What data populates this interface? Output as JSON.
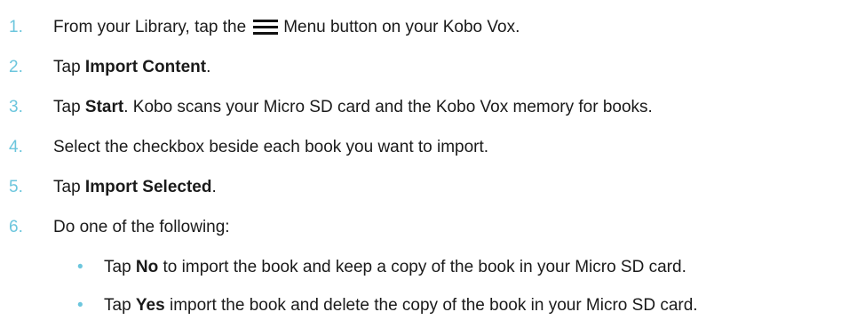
{
  "steps": [
    {
      "number": "1.",
      "before": "From your Library, tap the",
      "icon": "menu-icon",
      "after": "Menu button on your Kobo Vox."
    },
    {
      "number": "2.",
      "before": "Tap ",
      "bold": "Import Content",
      "after": "."
    },
    {
      "number": "3.",
      "before": "Tap ",
      "bold": "Start",
      "after": ". Kobo scans your Micro SD card and the Kobo Vox memory for books."
    },
    {
      "number": "4.",
      "text": "Select the checkbox beside each book you want to import."
    },
    {
      "number": "5.",
      "before": "Tap ",
      "bold": "Import Selected",
      "after": "."
    },
    {
      "number": "6.",
      "text": "Do one of the following:"
    }
  ],
  "substeps": [
    {
      "bullet": "•",
      "before": "Tap ",
      "bold": "No",
      "after": " to import the book and keep a copy of the book in your Micro SD card."
    },
    {
      "bullet": "•",
      "before": "Tap ",
      "bold": "Yes",
      "after": " import the book and delete the copy of the book in your Micro SD card."
    }
  ],
  "colors": {
    "accent": "#6cc6dd",
    "text": "#1a1a1a"
  }
}
